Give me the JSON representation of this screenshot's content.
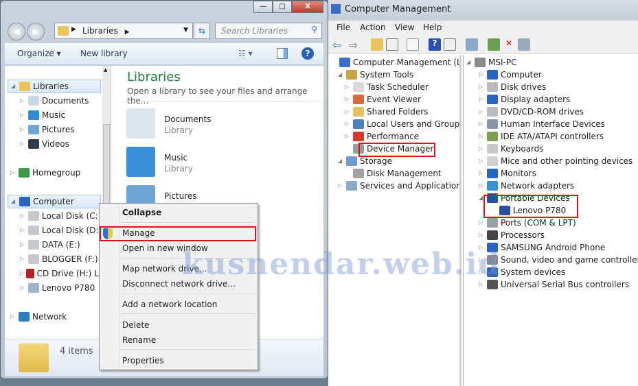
{
  "explorer": {
    "window_buttons": {
      "minimize": "—",
      "maximize": "□",
      "close": "X"
    },
    "address": "Libraries",
    "search_placeholder": "Search Libraries",
    "toolbar": {
      "organize": "Organize ▾",
      "new_library": "New library"
    },
    "nav": [
      {
        "label": "Libraries",
        "level": 0,
        "arrow": "◢",
        "icon": "libraries-icon",
        "color": "#e8c45a",
        "selected": true
      },
      {
        "label": "Documents",
        "level": 1,
        "arrow": "▷",
        "icon": "documents-icon",
        "color": "#c9d6e6"
      },
      {
        "label": "Music",
        "level": 1,
        "arrow": "▷",
        "icon": "music-icon",
        "color": "#2c8fd8"
      },
      {
        "label": "Pictures",
        "level": 1,
        "arrow": "▷",
        "icon": "pictures-icon",
        "color": "#6fa6d6"
      },
      {
        "label": "Videos",
        "level": 1,
        "arrow": "▷",
        "icon": "videos-icon",
        "color": "#333c48"
      },
      {
        "label": "Homegroup",
        "level": 0,
        "arrow": "▷",
        "icon": "homegroup-icon",
        "color": "#3a9a48"
      },
      {
        "label": "Computer",
        "level": 0,
        "arrow": "◢",
        "icon": "computer-icon",
        "color": "#2a63c0",
        "selected": true
      },
      {
        "label": "Local Disk (C:)",
        "level": 1,
        "arrow": "▷",
        "icon": "drive-icon",
        "color": "#c4c8cc"
      },
      {
        "label": "Local Disk (D:)",
        "level": 1,
        "arrow": "▷",
        "icon": "drive-icon",
        "color": "#c4c8cc"
      },
      {
        "label": "DATA (E:)",
        "level": 1,
        "arrow": "▷",
        "icon": "drive-icon",
        "color": "#c4c8cc"
      },
      {
        "label": "BLOGGER (F:)",
        "level": 1,
        "arrow": "▷",
        "icon": "drive-icon",
        "color": "#c4c8cc"
      },
      {
        "label": "CD Drive (H:) Le",
        "level": 1,
        "arrow": "▷",
        "icon": "cd-drive-icon",
        "color": "#b22222"
      },
      {
        "label": "Lenovo P780",
        "level": 1,
        "arrow": "▷",
        "icon": "phone-icon",
        "color": "#9fb4c8"
      },
      {
        "label": "Network",
        "level": 0,
        "arrow": "▷",
        "icon": "network-icon",
        "color": "#2a7fc0"
      }
    ],
    "content": {
      "title": "Libraries",
      "subtitle": "Open a library to see your files and arrange the...",
      "items": [
        {
          "name": "Documents",
          "type": "Library"
        },
        {
          "name": "Music",
          "type": "Library"
        },
        {
          "name": "Pictures",
          "type": ""
        }
      ]
    },
    "status": "4 items",
    "context_menu": [
      "Collapse",
      "Manage",
      "Open in new window",
      "Map network drive...",
      "Disconnect network drive...",
      "Add a network location",
      "Delete",
      "Rename",
      "Properties"
    ]
  },
  "cm": {
    "title": "Computer Management",
    "menu": [
      "File",
      "Action",
      "View",
      "Help"
    ],
    "left_tree": [
      {
        "label": "Computer Management (Local",
        "level": 0,
        "arrow": "",
        "color": "#3a6fc8"
      },
      {
        "label": "System Tools",
        "level": 1,
        "arrow": "◢",
        "color": "#c9a24a"
      },
      {
        "label": "Task Scheduler",
        "level": 2,
        "arrow": "▷",
        "color": "#d9d9d9"
      },
      {
        "label": "Event Viewer",
        "level": 2,
        "arrow": "▷",
        "color": "#d46b3a"
      },
      {
        "label": "Shared Folders",
        "level": 2,
        "arrow": "▷",
        "color": "#e2c064"
      },
      {
        "label": "Local Users and Groups",
        "level": 2,
        "arrow": "▷",
        "color": "#4a7fc0"
      },
      {
        "label": "Performance",
        "level": 2,
        "arrow": "▷",
        "color": "#d23b2b"
      },
      {
        "label": "Device Manager",
        "level": 2,
        "arrow": "",
        "color": "#9a9a9a"
      },
      {
        "label": "Storage",
        "level": 1,
        "arrow": "◢",
        "color": "#6f9bd0"
      },
      {
        "label": "Disk Management",
        "level": 2,
        "arrow": "",
        "color": "#a0a0a0"
      },
      {
        "label": "Services and Applications",
        "level": 1,
        "arrow": "▷",
        "color": "#8aa8c8"
      }
    ],
    "right_tree": [
      {
        "label": "MSI-PC",
        "level": 0,
        "arrow": "◢",
        "color": "#8a8a8a"
      },
      {
        "label": "Computer",
        "level": 1,
        "arrow": "▷",
        "color": "#2a63c0"
      },
      {
        "label": "Disk drives",
        "level": 1,
        "arrow": "▷",
        "color": "#b8bcc0"
      },
      {
        "label": "Display adapters",
        "level": 1,
        "arrow": "▷",
        "color": "#2a63c0"
      },
      {
        "label": "DVD/CD-ROM drives",
        "level": 1,
        "arrow": "▷",
        "color": "#b8bcc0"
      },
      {
        "label": "Human Interface Devices",
        "level": 1,
        "arrow": "▷",
        "color": "#8a96a8"
      },
      {
        "label": "IDE ATA/ATAPI controllers",
        "level": 1,
        "arrow": "▷",
        "color": "#7aa050"
      },
      {
        "label": "Keyboards",
        "level": 1,
        "arrow": "▷",
        "color": "#c8c8c8"
      },
      {
        "label": "Mice and other pointing devices",
        "level": 1,
        "arrow": "▷",
        "color": "#d0d0d0"
      },
      {
        "label": "Monitors",
        "level": 1,
        "arrow": "▷",
        "color": "#2a63c0"
      },
      {
        "label": "Network adapters",
        "level": 1,
        "arrow": "▷",
        "color": "#3a8fd0"
      },
      {
        "label": "Portable Devices",
        "level": 1,
        "arrow": "◢",
        "color": "#2a4fa0"
      },
      {
        "label": "Lenovo P780",
        "level": 2,
        "arrow": "",
        "color": "#2a4fa0"
      },
      {
        "label": "Ports (COM & LPT)",
        "level": 1,
        "arrow": "▷",
        "color": "#9aa0a8"
      },
      {
        "label": "Processors",
        "level": 1,
        "arrow": "▷",
        "color": "#444"
      },
      {
        "label": "SAMSUNG Android Phone",
        "level": 1,
        "arrow": "▷",
        "color": "#2a63c0"
      },
      {
        "label": "Sound, video and game controllers",
        "level": 1,
        "arrow": "▷",
        "color": "#888"
      },
      {
        "label": "System devices",
        "level": 1,
        "arrow": "▷",
        "color": "#2a63c0"
      },
      {
        "label": "Universal Serial Bus controllers",
        "level": 1,
        "arrow": "▷",
        "color": "#555"
      }
    ]
  },
  "watermark": "kusnendar.web.id",
  "highlight_color": "#e0101a"
}
